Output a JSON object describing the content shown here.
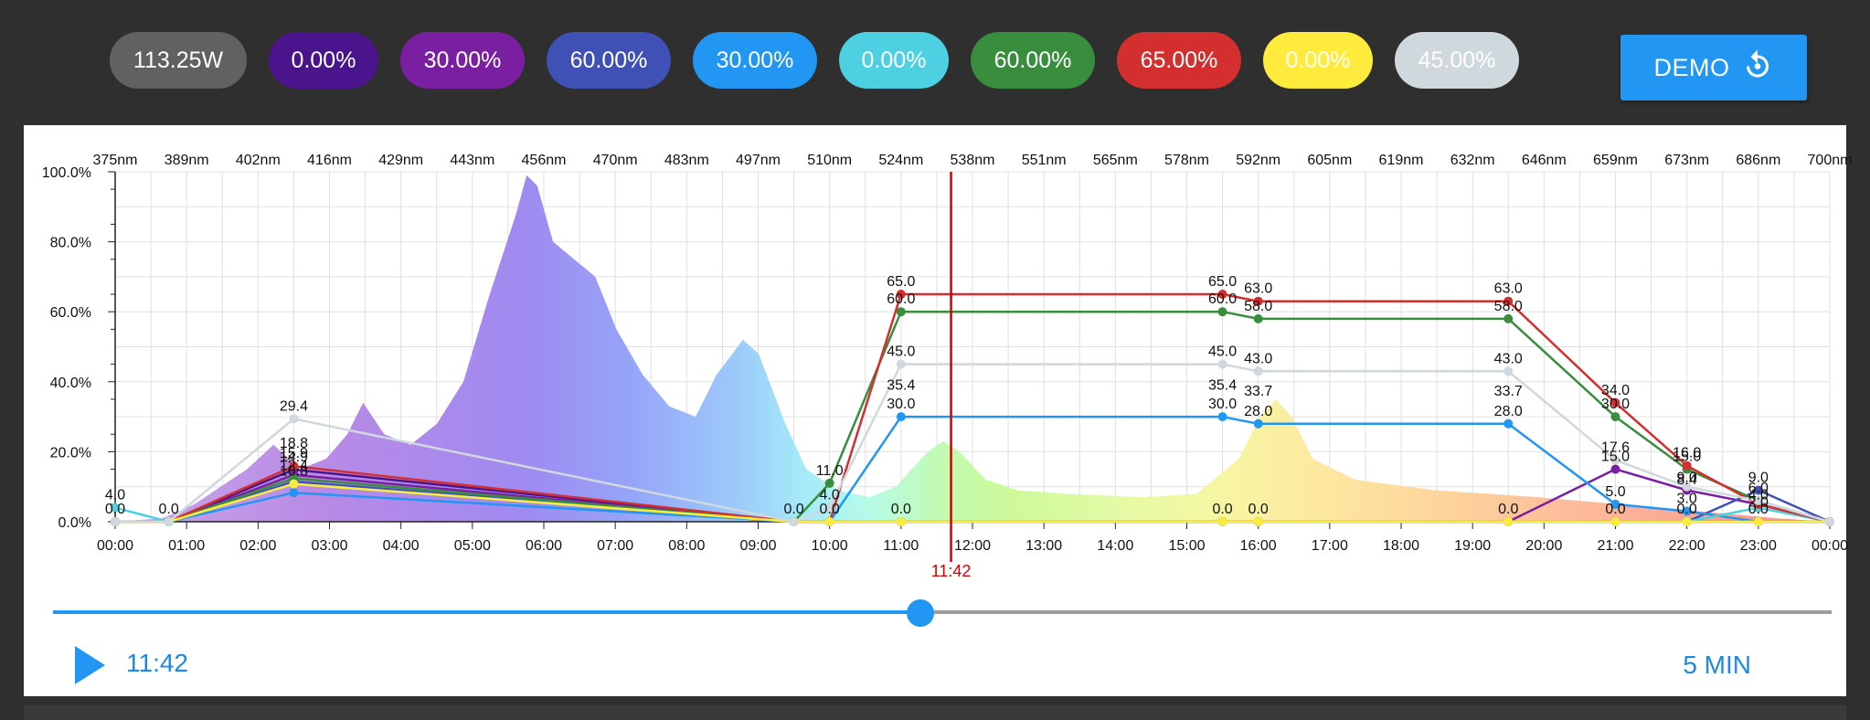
{
  "pills": [
    {
      "label": "113.25W",
      "color": "#616161",
      "text": "#ffffff"
    },
    {
      "label": "0.00%",
      "color": "#4a148c",
      "text": "#ffffff"
    },
    {
      "label": "30.00%",
      "color": "#7b1fa2",
      "text": "#ffffff"
    },
    {
      "label": "60.00%",
      "color": "#3f51b5",
      "text": "#ffffff"
    },
    {
      "label": "30.00%",
      "color": "#2196f3",
      "text": "#ffffff"
    },
    {
      "label": "0.00%",
      "color": "#4dd0e1",
      "text": "#ffffff"
    },
    {
      "label": "60.00%",
      "color": "#388e3c",
      "text": "#ffffff"
    },
    {
      "label": "65.00%",
      "color": "#d32f2f",
      "text": "#ffffff"
    },
    {
      "label": "0.00%",
      "color": "#ffeb3b",
      "text": "#ffffff"
    },
    {
      "label": "45.00%",
      "color": "#cfd8dc",
      "text": "#ffffff"
    }
  ],
  "demo_label": "DEMO",
  "player": {
    "time": "11:42",
    "speed": "5 MIN",
    "progress": 0.4875
  },
  "chart_data": {
    "type": "line",
    "xlim": [
      0,
      24
    ],
    "ylim": [
      0,
      100
    ],
    "xticks": [
      "00:00",
      "01:00",
      "02:00",
      "03:00",
      "04:00",
      "05:00",
      "06:00",
      "07:00",
      "08:00",
      "09:00",
      "10:00",
      "11:00",
      "12:00",
      "13:00",
      "14:00",
      "15:00",
      "16:00",
      "17:00",
      "18:00",
      "19:00",
      "20:00",
      "21:00",
      "22:00",
      "23:00",
      "00:00"
    ],
    "yticks": [
      "0.0%",
      "20.0%",
      "40.0%",
      "60.0%",
      "80.0%",
      "100.0%"
    ],
    "wavelength_ticks": [
      "375nm",
      "389nm",
      "402nm",
      "416nm",
      "429nm",
      "443nm",
      "456nm",
      "470nm",
      "483nm",
      "497nm",
      "510nm",
      "524nm",
      "538nm",
      "551nm",
      "565nm",
      "578nm",
      "592nm",
      "605nm",
      "619nm",
      "632nm",
      "646nm",
      "659nm",
      "673nm",
      "686nm",
      "700nm"
    ],
    "wavelength_range": [
      375,
      700
    ],
    "current_time": {
      "x": 11.7,
      "label": "11:42"
    },
    "grid": true,
    "spectrum": [
      [
        375,
        0
      ],
      [
        384,
        1
      ],
      [
        390,
        5
      ],
      [
        400,
        15
      ],
      [
        405,
        22
      ],
      [
        410,
        15
      ],
      [
        415,
        18
      ],
      [
        419,
        25
      ],
      [
        422,
        34
      ],
      [
        426,
        25
      ],
      [
        431,
        22
      ],
      [
        436,
        28
      ],
      [
        441,
        40
      ],
      [
        446,
        65
      ],
      [
        451,
        88
      ],
      [
        453,
        99
      ],
      [
        455,
        96
      ],
      [
        458,
        80
      ],
      [
        462,
        75
      ],
      [
        466,
        70
      ],
      [
        470,
        55
      ],
      [
        475,
        42
      ],
      [
        480,
        33
      ],
      [
        485,
        30
      ],
      [
        489,
        42
      ],
      [
        494,
        52
      ],
      [
        497,
        48
      ],
      [
        502,
        28
      ],
      [
        506,
        15
      ],
      [
        512,
        9
      ],
      [
        518,
        7
      ],
      [
        523,
        10
      ],
      [
        529,
        20
      ],
      [
        532,
        23
      ],
      [
        535,
        20
      ],
      [
        540,
        12
      ],
      [
        546,
        9
      ],
      [
        555,
        8
      ],
      [
        570,
        7
      ],
      [
        580,
        8
      ],
      [
        588,
        18
      ],
      [
        592,
        30
      ],
      [
        595,
        35
      ],
      [
        598,
        30
      ],
      [
        602,
        18
      ],
      [
        610,
        12
      ],
      [
        625,
        9
      ],
      [
        645,
        7
      ],
      [
        660,
        5
      ],
      [
        675,
        3
      ],
      [
        690,
        1
      ],
      [
        700,
        0
      ]
    ],
    "series": [
      {
        "color": "#4a148c",
        "x": [
          0,
          0.75,
          2.5,
          9.5,
          10.0,
          11.0,
          15.5,
          16.0,
          19.5,
          21.0,
          22.0,
          23.0,
          24.0
        ],
        "y": [
          0,
          0,
          14.9,
          0,
          0,
          0,
          0,
          0,
          0,
          0,
          0,
          0,
          0
        ]
      },
      {
        "color": "#7b1fa2",
        "x": [
          0,
          0.75,
          2.5,
          9.5,
          10.0,
          11.0,
          15.5,
          16.0,
          19.5,
          21.0,
          22.0,
          23.0,
          24.0
        ],
        "y": [
          0,
          0,
          13.4,
          0,
          0,
          0,
          0,
          0,
          0,
          15.0,
          9.0,
          5.0,
          0
        ]
      },
      {
        "color": "#3f51b5",
        "x": [
          0,
          0.75,
          2.5,
          9.5,
          10.0,
          11.0,
          15.5,
          16.0,
          19.5,
          21.0,
          22.0,
          23.0,
          24.0
        ],
        "y": [
          0,
          0,
          11.5,
          0,
          0,
          0,
          0,
          0,
          0,
          0,
          0,
          9.0,
          0
        ]
      },
      {
        "color": "#2196f3",
        "x": [
          0,
          0.75,
          2.5,
          9.5,
          10.0,
          11.0,
          15.5,
          16.0,
          19.5,
          21.0,
          22.0,
          23.0,
          24.0
        ],
        "y": [
          0,
          0,
          8.3,
          0,
          0,
          30.0,
          30.0,
          28.0,
          28.0,
          5.0,
          3.0,
          0,
          0
        ]
      },
      {
        "color": "#4dd0e1",
        "x": [
          0,
          0.75,
          2.5,
          9.5,
          10.0,
          11.0,
          15.5,
          16.0,
          19.5,
          21.0,
          22.0,
          23.0,
          24.0
        ],
        "y": [
          4.0,
          0,
          10.8,
          0,
          0,
          0,
          0,
          0,
          0,
          0,
          0,
          4.0,
          0
        ]
      },
      {
        "color": "#388e3c",
        "x": [
          0,
          0.75,
          2.5,
          9.5,
          10.0,
          11.0,
          15.5,
          16.0,
          19.5,
          21.0,
          22.0,
          23.0,
          24.0
        ],
        "y": [
          0,
          0,
          12.4,
          0,
          11.0,
          60.0,
          60.0,
          58.0,
          58.0,
          30.0,
          15.0,
          6.0,
          0
        ]
      },
      {
        "color": "#d32f2f",
        "x": [
          0,
          0.75,
          2.5,
          9.5,
          10.0,
          11.0,
          15.5,
          16.0,
          19.5,
          21.0,
          22.0,
          23.0,
          24.0
        ],
        "y": [
          0,
          0,
          15.9,
          0,
          0,
          65.0,
          65.0,
          63.0,
          63.0,
          34.0,
          16.0,
          5.0,
          0
        ]
      },
      {
        "color": "#ffeb3b",
        "x": [
          0,
          0.75,
          2.5,
          9.5,
          10.0,
          11.0,
          15.5,
          16.0,
          19.5,
          21.0,
          22.0,
          23.0,
          24.0
        ],
        "y": [
          0,
          0,
          10.8,
          0,
          0,
          0,
          0,
          0,
          0,
          0,
          0,
          0,
          0
        ]
      },
      {
        "color": "#cfd8dc",
        "x": [
          0,
          0.75,
          2.5,
          9.5,
          10.0,
          11.0,
          15.5,
          16.0,
          19.5,
          21.0,
          22.0,
          23.0,
          24.0
        ],
        "y": [
          0,
          0,
          29.4,
          0,
          4.0,
          45.0,
          45.0,
          43.0,
          43.0,
          17.6,
          10.0,
          6.0,
          0
        ]
      }
    ],
    "data_labels": [
      {
        "x": 0,
        "y": 4.0,
        "text": "4.0"
      },
      {
        "x": 0,
        "y": 0,
        "text": "0.0"
      },
      {
        "x": 0.75,
        "y": 0,
        "text": "0.0"
      },
      {
        "x": 2.5,
        "y": 29.4,
        "text": "29.4"
      },
      {
        "x": 2.5,
        "y": 18.8,
        "text": "18.8"
      },
      {
        "x": 2.5,
        "y": 15.9,
        "text": "15.9"
      },
      {
        "x": 2.5,
        "y": 14.9,
        "text": "14.9"
      },
      {
        "x": 2.5,
        "y": 12.4,
        "text": "12.4"
      },
      {
        "x": 2.5,
        "y": 10.8,
        "text": "10.8"
      },
      {
        "x": 9.5,
        "y": 0,
        "text": "0.0"
      },
      {
        "x": 10.0,
        "y": 11.0,
        "text": "11.0"
      },
      {
        "x": 10.0,
        "y": 4.0,
        "text": "4.0"
      },
      {
        "x": 10.0,
        "y": 0,
        "text": "0.0"
      },
      {
        "x": 11.0,
        "y": 65.0,
        "text": "65.0"
      },
      {
        "x": 11.0,
        "y": 60.0,
        "text": "60.0"
      },
      {
        "x": 11.0,
        "y": 45.0,
        "text": "45.0"
      },
      {
        "x": 11.0,
        "y": 35.4,
        "text": "35.4"
      },
      {
        "x": 11.0,
        "y": 30.0,
        "text": "30.0"
      },
      {
        "x": 11.0,
        "y": 0,
        "text": "0.0"
      },
      {
        "x": 15.5,
        "y": 65.0,
        "text": "65.0"
      },
      {
        "x": 15.5,
        "y": 60.0,
        "text": "60.0"
      },
      {
        "x": 15.5,
        "y": 45.0,
        "text": "45.0"
      },
      {
        "x": 15.5,
        "y": 35.4,
        "text": "35.4"
      },
      {
        "x": 15.5,
        "y": 30.0,
        "text": "30.0"
      },
      {
        "x": 15.5,
        "y": 0,
        "text": "0.0"
      },
      {
        "x": 16.0,
        "y": 63.0,
        "text": "63.0"
      },
      {
        "x": 16.0,
        "y": 58.0,
        "text": "58.0"
      },
      {
        "x": 16.0,
        "y": 43.0,
        "text": "43.0"
      },
      {
        "x": 16.0,
        "y": 33.7,
        "text": "33.7"
      },
      {
        "x": 16.0,
        "y": 28.0,
        "text": "28.0"
      },
      {
        "x": 16.0,
        "y": 0,
        "text": "0.0"
      },
      {
        "x": 19.5,
        "y": 63.0,
        "text": "63.0"
      },
      {
        "x": 19.5,
        "y": 58.0,
        "text": "58.0"
      },
      {
        "x": 19.5,
        "y": 43.0,
        "text": "43.0"
      },
      {
        "x": 19.5,
        "y": 33.7,
        "text": "33.7"
      },
      {
        "x": 19.5,
        "y": 28.0,
        "text": "28.0"
      },
      {
        "x": 19.5,
        "y": 0,
        "text": "0.0"
      },
      {
        "x": 21.0,
        "y": 34.0,
        "text": "34.0"
      },
      {
        "x": 21.0,
        "y": 30.0,
        "text": "30.0"
      },
      {
        "x": 21.0,
        "y": 17.6,
        "text": "17.6"
      },
      {
        "x": 21.0,
        "y": 15.0,
        "text": "15.0"
      },
      {
        "x": 21.0,
        "y": 5.0,
        "text": "5.0"
      },
      {
        "x": 21.0,
        "y": 0,
        "text": "0.0"
      },
      {
        "x": 22.0,
        "y": 16.0,
        "text": "16.0"
      },
      {
        "x": 22.0,
        "y": 15.0,
        "text": "15.0"
      },
      {
        "x": 22.0,
        "y": 9.0,
        "text": "9.0"
      },
      {
        "x": 22.0,
        "y": 8.4,
        "text": "8.4"
      },
      {
        "x": 22.0,
        "y": 3.0,
        "text": "3.0"
      },
      {
        "x": 22.0,
        "y": 0,
        "text": "0.0"
      },
      {
        "x": 23.0,
        "y": 9.0,
        "text": "9.0"
      },
      {
        "x": 23.0,
        "y": 6.0,
        "text": "6.0"
      },
      {
        "x": 23.0,
        "y": 4.0,
        "text": "4.0"
      },
      {
        "x": 23.0,
        "y": 2.0,
        "text": "2.0"
      },
      {
        "x": 23.0,
        "y": 0,
        "text": "0.0"
      }
    ]
  }
}
